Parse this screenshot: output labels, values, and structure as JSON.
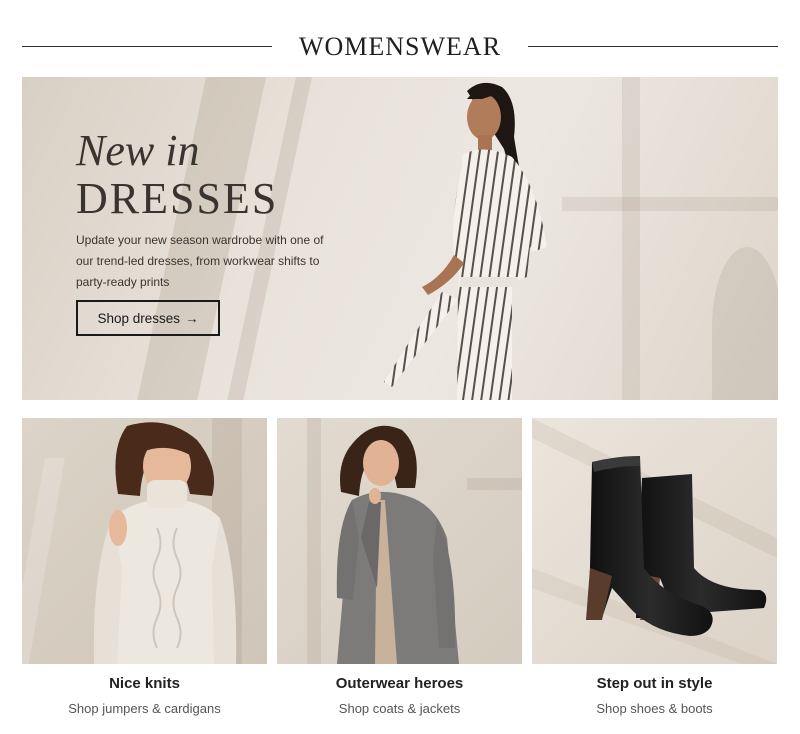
{
  "header": {
    "title": "WOMENSWEAR"
  },
  "hero": {
    "kicker": "New in",
    "headline": "DRESSES",
    "description": "Update your new season wardrobe with one of our trend-led dresses, from workwear shifts to party-ready prints",
    "cta_label": "Shop dresses",
    "cta_arrow": "→"
  },
  "cards": [
    {
      "title": "Nice knits",
      "link": "Shop jumpers & cardigans"
    },
    {
      "title": "Outerwear heroes",
      "link": "Shop coats & jackets"
    },
    {
      "title": "Step out in style",
      "link": "Shop shoes & boots"
    }
  ]
}
